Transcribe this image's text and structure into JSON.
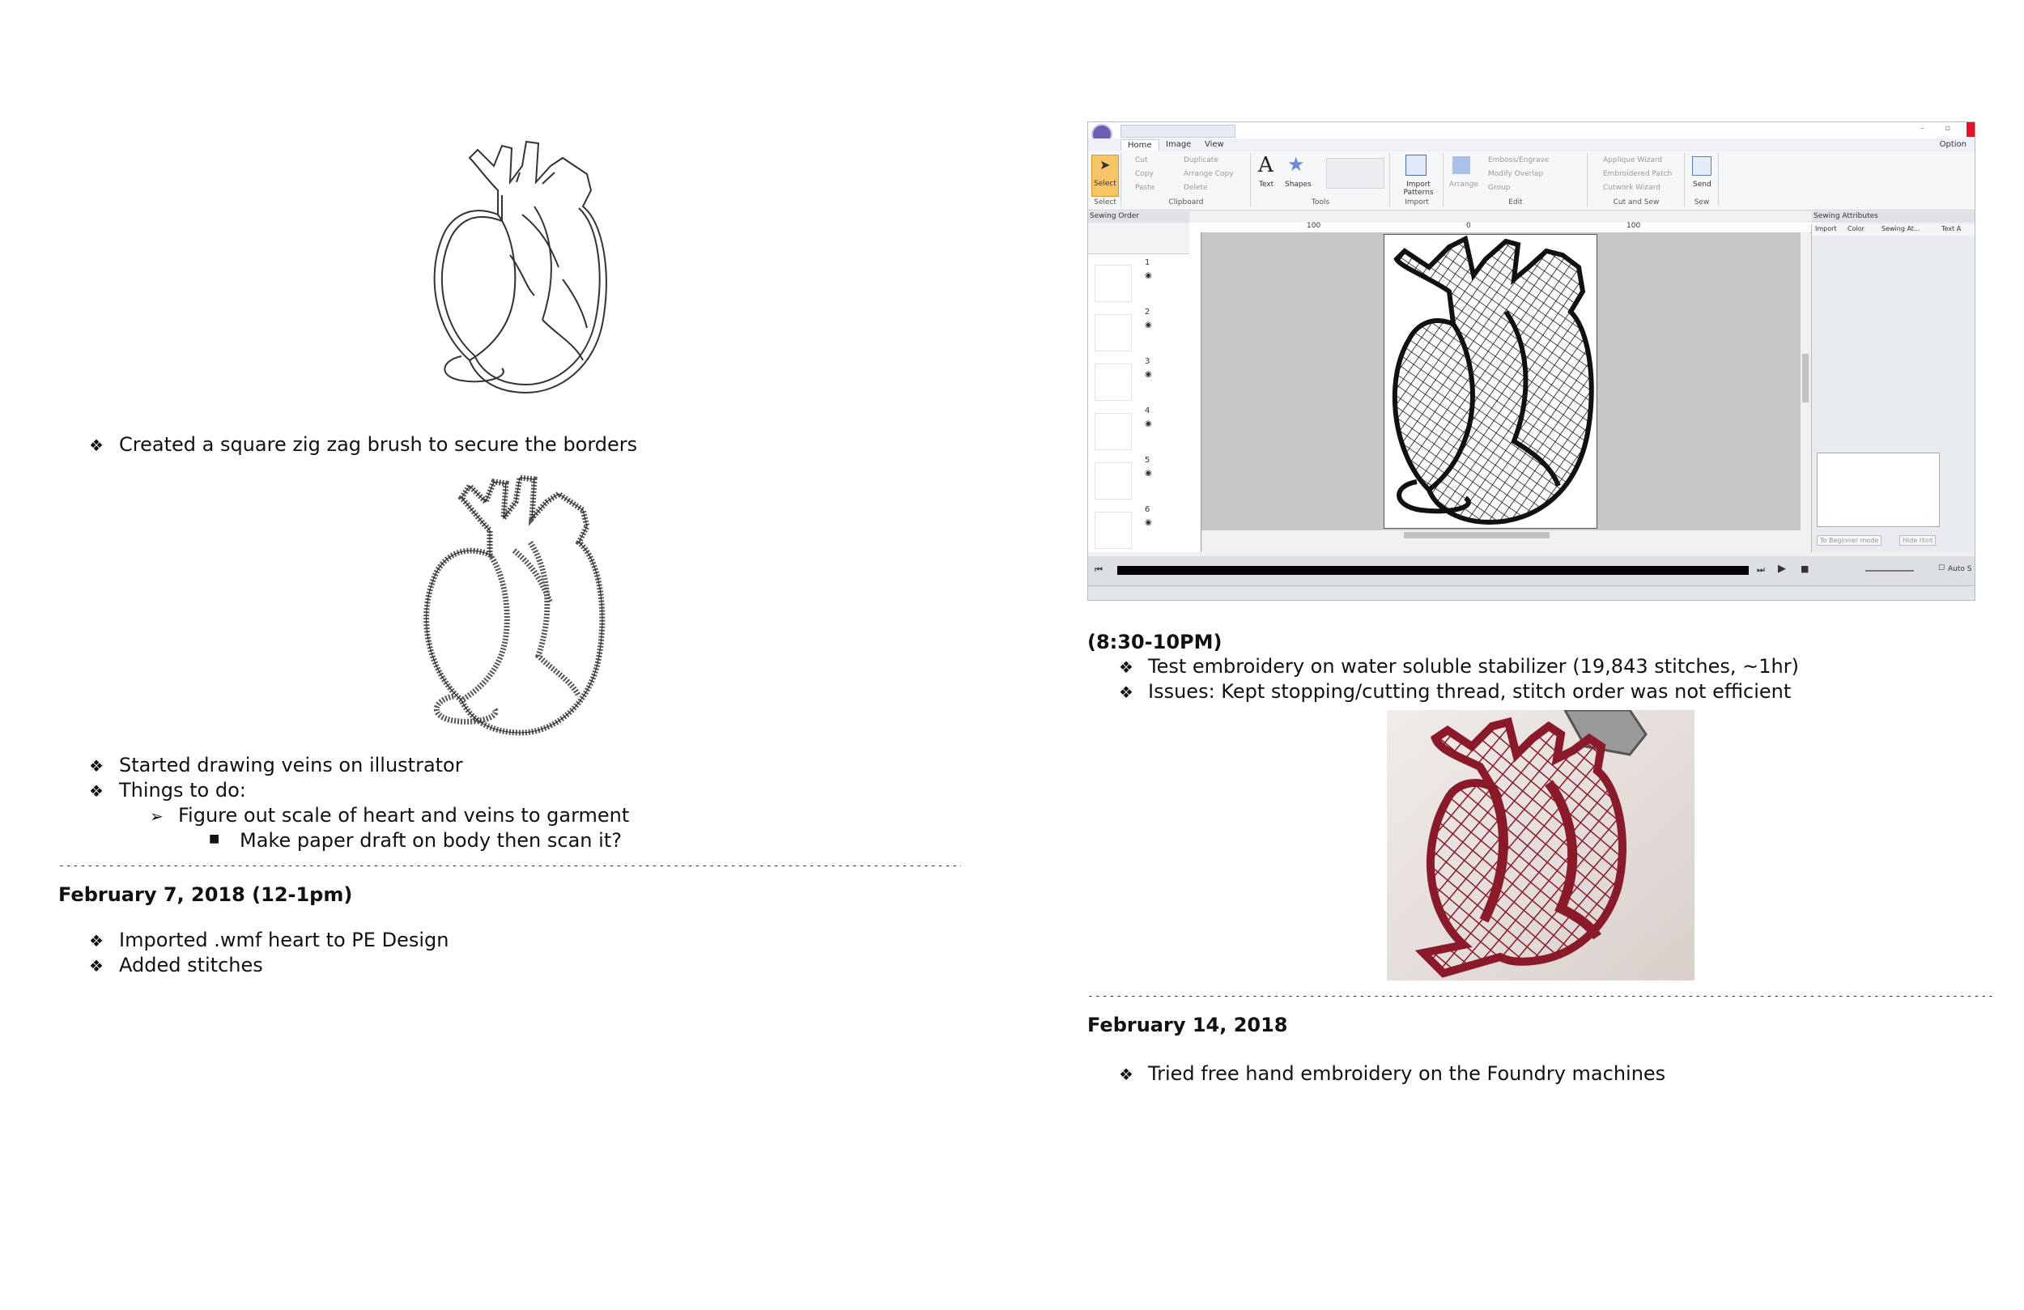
{
  "left": {
    "bullet_symbol": "❖",
    "arrow_symbol": "➢",
    "square_symbol": "■",
    "item_zigzag": "Created a square zig zag brush to secure the borders",
    "item_veins": "Started drawing veins on illustrator",
    "item_todo": "Things to do:",
    "item_scale": "Figure out scale of heart and veins to garment",
    "item_draft": "Make paper draft on body then scan it?",
    "divider": "------------------------------------------------------------------------------------------------------------------------------------------------------",
    "date_feb7": "February 7, 2018 (12-1pm)",
    "item_imported": "Imported .wmf heart to PE Design",
    "item_added": "Added stitches"
  },
  "right": {
    "time_label": "(8:30-10PM)",
    "item_test": "Test embroidery on water soluble stabilizer (19,843 stitches, ~1hr)",
    "item_issues": "Issues: Kept stopping/cutting thread, stitch order was not efficient",
    "divider": "------------------------------------------------------------------------------------------------------------------------------------------------------",
    "date_feb14": "February 14, 2018",
    "item_freehand": "Tried free hand embroidery on the Foundry machines"
  },
  "pe_design": {
    "tabs": [
      "Home",
      "Image",
      "View"
    ],
    "option_label": "Option",
    "groups": [
      "Select",
      "Clipboard",
      "Tools",
      "Import",
      "Edit",
      "Cut and Sew",
      "Sew"
    ],
    "select_label": "Select",
    "clipboard_items": [
      "Cut",
      "Copy",
      "Paste",
      "Duplicate",
      "Arrange Copy",
      "Delete"
    ],
    "text_label": "Text",
    "shapes_label": "Shapes",
    "import_patterns_label": "Import Patterns",
    "arrange_label": "Arrange",
    "edit_items": [
      "Emboss/Engrave",
      "Modify Overlap",
      "Group"
    ],
    "cut_sew_items": [
      "Applique Wizard",
      "Embroidered Patch",
      "Cutwork Wizard"
    ],
    "send_label": "Send",
    "sewing_order_title": "Sewing Order",
    "sewing_order_numbers": [
      "1",
      "2",
      "3",
      "4",
      "5",
      "6"
    ],
    "sewing_attributes_title": "Sewing Attributes",
    "attr_tabs": [
      "Import",
      "Color",
      "Sewing At...",
      "Text A"
    ],
    "ruler_marks": [
      "100",
      "0",
      "100"
    ],
    "beginner_mode_label": "To Beginner mode",
    "hide_hint_label": "Hide Hint",
    "auto_label": "Auto S"
  },
  "colors": {
    "embroidery_red": "#8a1a2a",
    "photo_bg": "#e9e2de",
    "ribbon_accent": "#f0a020"
  }
}
